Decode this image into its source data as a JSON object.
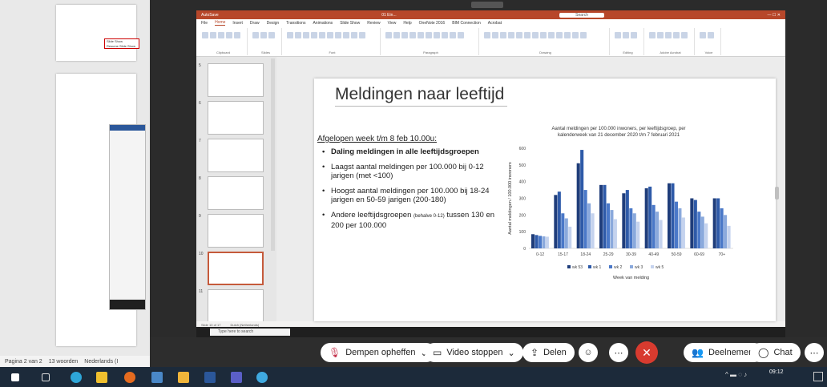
{
  "word": {
    "status_page": "Pagina 2 van 2",
    "status_words": "13 woorden",
    "status_lang": "Nederlands (I"
  },
  "ppt": {
    "title_left": "AutoSave",
    "title_file": "01 Ein...",
    "title_search": "Search",
    "tabs": [
      "File",
      "Home",
      "Insert",
      "Draw",
      "Design",
      "Transitions",
      "Animations",
      "Slide Show",
      "Review",
      "View",
      "Help",
      "OneNote 2016",
      "BIM Connection",
      "Acrobat"
    ],
    "tooltip_line1": "Slide Show",
    "tooltip_line2": "Resume Slide Show",
    "thumb_numbers": [
      "5",
      "6",
      "7",
      "8",
      "9",
      "10",
      "11"
    ],
    "status_left": "Slide 10 of 17",
    "status_lang": "Dutch (Netherlands)",
    "ribbon_groups": [
      "Clipboard",
      "Slides",
      "Font",
      "Paragraph",
      "Drawing",
      "Editing",
      "Adobe Acrobat",
      "Voice"
    ]
  },
  "slide": {
    "title": "Meldingen naar leeftijd",
    "subtitle": "Afgelopen week t/m 8 feb 10.00u:",
    "bullets": [
      "Daling meldingen in alle leeftijdsgroepen",
      "Laagst aantal meldingen per 100.000 bij 0-12 jarigen (met <100)",
      "Hoogst aantal meldingen per 100.000 bij 18-24 jarigen en 50-59 jarigen (200-180)"
    ],
    "bullet4_pre": "Andere leeftijdsgroepen",
    "bullet4_small": "(behalve 0-12)",
    "bullet4_post": "tussen 130 en 200 per 100.000"
  },
  "meeting": {
    "mute_label": "Dempen opheffen",
    "video_label": "Video stoppen",
    "share_label": "Delen",
    "participants_label": "Deelnemers",
    "chat_label": "Chat"
  },
  "taskbar": {
    "time": "09:12",
    "search_placeholder": "Type here to search"
  },
  "chart_data": {
    "type": "bar",
    "title": "Aantal meldingen per 100.000 inwoners, per leeftijdsgroep, per kalenderweek van 21 december 2020 t/m 7 februari 2021",
    "xlabel": "Week van melding",
    "ylabel": "Aantal meldingen / 100.000 inwoners",
    "ylim": [
      0,
      600
    ],
    "yticks": [
      0,
      100,
      200,
      300,
      400,
      500,
      600
    ],
    "categories": [
      "0-12",
      "15-17",
      "18-24",
      "25-29",
      "30-39",
      "40-49",
      "50-59",
      "60-69",
      "70+"
    ],
    "series": [
      {
        "name": "wk 53",
        "color": "#1f3d7a",
        "values": [
          85,
          320,
          510,
          380,
          330,
          360,
          390,
          300,
          300
        ]
      },
      {
        "name": "wk 1",
        "color": "#2e5aa8",
        "values": [
          80,
          340,
          590,
          380,
          350,
          370,
          390,
          290,
          300
        ]
      },
      {
        "name": "wk 2",
        "color": "#4a78c8",
        "values": [
          75,
          210,
          350,
          270,
          240,
          260,
          280,
          220,
          240
        ]
      },
      {
        "name": "wk 3",
        "color": "#8aa9dc",
        "values": [
          72,
          180,
          270,
          230,
          210,
          220,
          240,
          190,
          200
        ]
      },
      {
        "name": "wk 5",
        "color": "#c5d3ee",
        "values": [
          70,
          130,
          210,
          175,
          160,
          170,
          185,
          150,
          135
        ]
      }
    ],
    "legend_position": "bottom"
  }
}
